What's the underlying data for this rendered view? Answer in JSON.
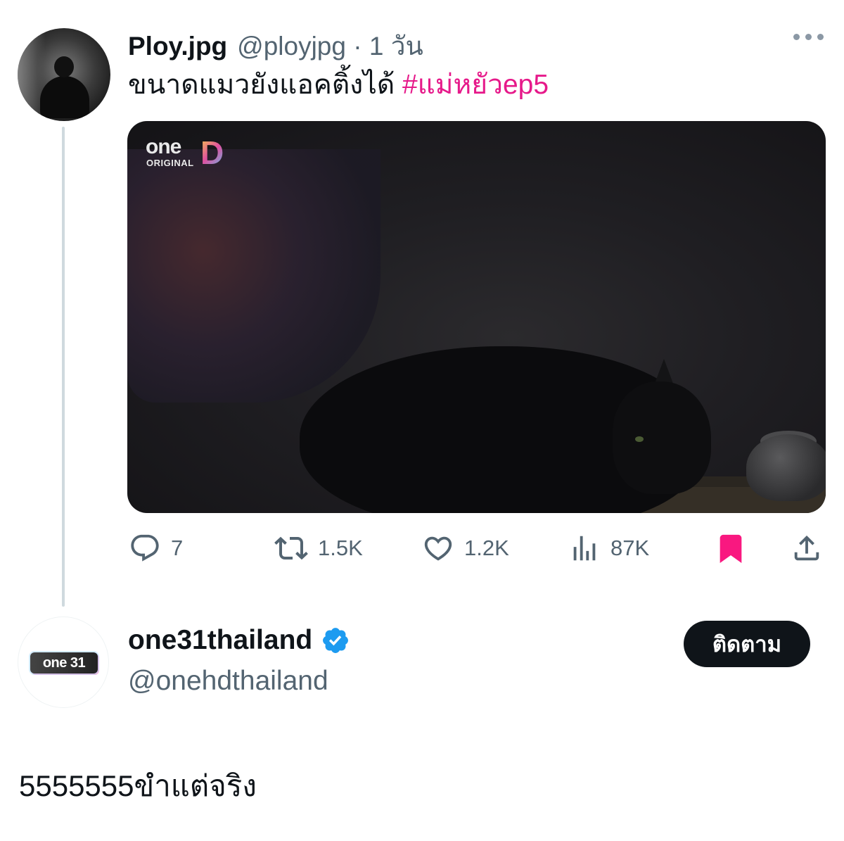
{
  "parent_tweet": {
    "display_name": "Ploy.jpg",
    "handle_time": "@ployjpg · 1 วัน",
    "text": "ขนาดแมวยังแอคติ้งได้ ",
    "hashtag": "#แม่หยัวep5",
    "media": {
      "watermark_top": "one",
      "watermark_letter": "D",
      "watermark_bottom": "ORIGINAL"
    },
    "actions": {
      "replies": "7",
      "reposts": "1.5K",
      "likes": "1.2K",
      "views": "87K"
    },
    "icons": [
      "more-icon",
      "reply-icon",
      "repost-icon",
      "like-icon",
      "views-icon",
      "bookmark-icon",
      "share-icon"
    ],
    "colors": {
      "hashtag": "#e6198a",
      "bookmark": "#f91880",
      "muted": "#536471"
    }
  },
  "reply": {
    "display_name": "one31thailand",
    "verified": true,
    "handle": "@onehdthailand",
    "avatar_brand": "one 31",
    "follow_label": "ติดตาม",
    "text": "5555555ขำแต่จริง",
    "colors": {
      "verified": "#1d9bf0",
      "follow_bg": "#0f1419"
    }
  }
}
